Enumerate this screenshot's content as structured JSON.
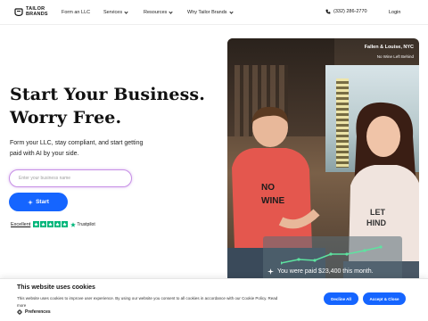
{
  "brand": {
    "line1": "TAILOR",
    "line2": "BRANDS",
    "color": "#151515"
  },
  "nav": [
    {
      "label": "Form an LLC",
      "dropdown": false
    },
    {
      "label": "Services",
      "dropdown": true
    },
    {
      "label": "Resources",
      "dropdown": true
    },
    {
      "label": "Why Tailor Brands",
      "dropdown": true
    }
  ],
  "header": {
    "phone": "(332) 286-2770",
    "login": "Login"
  },
  "hero": {
    "title_line1": "Start Your Business.",
    "title_line2": "Worry Free.",
    "subtitle": "Form your LLC, stay compliant, and start getting paid with AI by your side.",
    "input_placeholder": "Enter your business name",
    "start_label": "Start",
    "accent": "#1565ff"
  },
  "trustpilot": {
    "label": "Excellent",
    "stars": 5,
    "brand": "Trustpilot",
    "color": "#00b67a"
  },
  "photo": {
    "location": "Fallen & Louise, NYC",
    "business": "No Wine Left Behind",
    "earnings_text": "You were paid $23,400 this month."
  },
  "cookie": {
    "title": "This website uses cookies",
    "text": "This website uses cookies to improve user experience. By using our website you consent to all cookies in accordance with our Cookie Policy. Read more",
    "preferences": "Preferences",
    "decline": "Decline All",
    "accept": "Accept & Close"
  }
}
